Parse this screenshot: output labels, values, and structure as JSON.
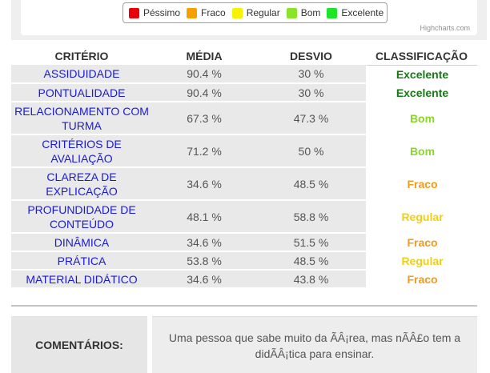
{
  "legend": {
    "items": [
      {
        "label": "Péssimo",
        "color": "#e8000b"
      },
      {
        "label": "Fraco",
        "color": "#f5a000"
      },
      {
        "label": "Regular",
        "color": "#f7f200"
      },
      {
        "label": "Bom",
        "color": "#89e42a"
      },
      {
        "label": "Excelente",
        "color": "#1de528"
      }
    ]
  },
  "credits": "Highcharts.com",
  "table": {
    "headers": {
      "criterio": "CRITÉRIO",
      "media": "MÉDIA",
      "desvio": "DESVIO",
      "classificacao": "CLASSIFICAÇÃO"
    },
    "rows": [
      {
        "criterio": "ASSIDUIDADE",
        "media": "90.4 %",
        "desvio": "30 %",
        "classificacao": "Excelente",
        "color": "#147a14"
      },
      {
        "criterio": "PONTUALIDADE",
        "media": "90.4 %",
        "desvio": "30 %",
        "classificacao": "Excelente",
        "color": "#147a14"
      },
      {
        "criterio": "RELACIONAMENTO COM TURMA",
        "media": "67.3 %",
        "desvio": "47.3 %",
        "classificacao": "Bom",
        "color": "#8bd629"
      },
      {
        "criterio": "CRITÉRIOS DE AVALIAÇÃO",
        "media": "71.2 %",
        "desvio": "50 %",
        "classificacao": "Bom",
        "color": "#8bd629"
      },
      {
        "criterio": "CLAREZA DE EXPLICAÇÃO",
        "media": "34.6 %",
        "desvio": "48.5 %",
        "classificacao": "Fraco",
        "color": "#f39a1c"
      },
      {
        "criterio": "PROFUNDIDADE DE CONTEÚDO",
        "media": "48.1 %",
        "desvio": "58.8 %",
        "classificacao": "Regular",
        "color": "#f0cf14"
      },
      {
        "criterio": "DINÂMICA",
        "media": "34.6 %",
        "desvio": "51.5 %",
        "classificacao": "Fraco",
        "color": "#f39a1c"
      },
      {
        "criterio": "PRÁTICA",
        "media": "53.8 %",
        "desvio": "48.5 %",
        "classificacao": "Regular",
        "color": "#f0cf14"
      },
      {
        "criterio": "MATERIAL DIDÁTICO",
        "media": "34.6 %",
        "desvio": "43.8 %",
        "classificacao": "Fraco",
        "color": "#f39a1c"
      }
    ]
  },
  "comments": {
    "label": "COMENTÁRIOS:",
    "text": "Uma pessoa que sabe muito da ÃÂ¡rea, mas nÃÂ£o tem a didÃÂ¡tica para ensinar."
  }
}
